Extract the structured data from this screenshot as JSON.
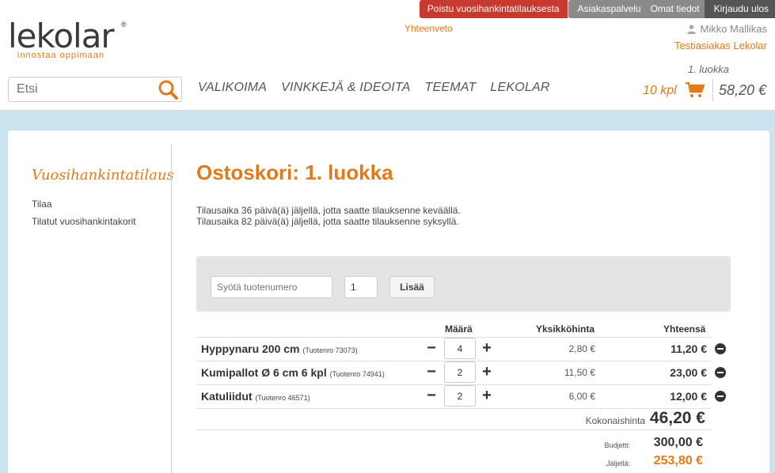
{
  "brand": {
    "name": "lekolar",
    "registered": "®",
    "tagline": "innostaa oppimaan"
  },
  "topbar": {
    "exit_label": "Poistu vuosihankintatilauksesta",
    "customer_service": "Asiakaspalvelu",
    "my_info": "Omat tiedot",
    "logout": "Kirjaudu ulos"
  },
  "summary_link": "Yhteenveto",
  "user": {
    "name": "Mikko Mallikas",
    "customer": "Testiasiakas Lekolar"
  },
  "search": {
    "placeholder": "Etsi",
    "value": ""
  },
  "nav": [
    "VALIKOIMA",
    "VINKKEJÄ & IDEOITA",
    "TEEMAT",
    "LEKOLAR"
  ],
  "cart": {
    "class_name": "1. luokka",
    "count": "10 kpl",
    "total": "58,20 €"
  },
  "sidebar": {
    "title": "Vuosihankintatilaus",
    "links": [
      "Tilaa",
      "Tilatut vuosihankintakorit"
    ]
  },
  "main": {
    "title": "Ostoskori: 1. luokka",
    "notices": [
      "Tilausaika 36 päivä(ä) jäljellä, jotta saatte tilauksenne keväällä.",
      "Tilausaika 82 päivä(ä) jäljellä, jotta saatte tilauksenne syksyllä."
    ],
    "add_form": {
      "product_placeholder": "Syötä tuotenumero",
      "qty_value": "1",
      "add_label": "Lisää"
    },
    "table": {
      "headers": {
        "qty": "Määrä",
        "unit_price": "Yksikköhinta",
        "total": "Yhteensä"
      },
      "rows": [
        {
          "name": "Hyppynaru 200 cm",
          "prodno": "(Tuotenro 73073)",
          "qty": "4",
          "unit": "2,80 €",
          "total": "11,20 €"
        },
        {
          "name": "Kumipallot Ø 6 cm 6 kpl",
          "prodno": "(Tuotenro 74941)",
          "qty": "2",
          "unit": "11,50 €",
          "total": "23,00 €"
        },
        {
          "name": "Katuliidut",
          "prodno": "(Tuotenro 46571)",
          "qty": "2",
          "unit": "6,00 €",
          "total": "12,00 €"
        }
      ],
      "minus_symbol": "−",
      "plus_symbol": "+"
    },
    "totals": {
      "grand_label": "Kokonaishinta",
      "grand_value": "46,20 €",
      "budget_label": "Budjetti:",
      "budget_value": "300,00 €",
      "remaining_label": "Jäljellä:",
      "remaining_value": "253,80 €"
    }
  },
  "colors": {
    "accent": "#e07b1a",
    "exit": "#c8392f",
    "page_bg": "#c9e3ef"
  }
}
